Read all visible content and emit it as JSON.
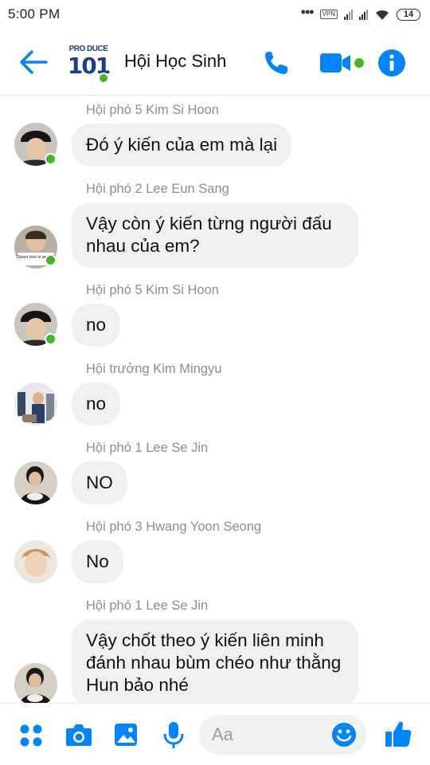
{
  "status_bar": {
    "time": "5:00 PM",
    "vpn": "VPN",
    "battery": "14"
  },
  "header": {
    "title": "Hội Học Sinh",
    "logo_top": "PRO DUCE",
    "logo_num": "101"
  },
  "colors": {
    "accent": "#0084ff",
    "online": "#42b72a",
    "bubble": "#f1f0f0",
    "sender": "#8a8d91"
  },
  "messages": [
    {
      "sender": "Hội phó 5 Kim Si Hoon",
      "text": "Đó ý kiến của em mà lại",
      "online": true
    },
    {
      "sender": "Hội phó 2 Lee Eun Sang",
      "text": "Vậy còn ý kiến từng người đấu nhau của em?",
      "online": true,
      "avatar_caption": "Gioeo tuoi vi anh cũ"
    },
    {
      "sender": "Hội phó 5 Kim Si Hoon",
      "text": "no",
      "online": true
    },
    {
      "sender": "Hội trưởng Kim Mingyu",
      "text": "no",
      "online": false
    },
    {
      "sender": "Hội phó 1 Lee Se Jin",
      "text": "NO",
      "online": false
    },
    {
      "sender": "Hội phó 3 Hwang Yoon Seong",
      "text": "No",
      "online": false
    },
    {
      "sender": "Hội phó 1 Lee Se Jin",
      "text": "Vậy chốt theo ý kiến liên minh đánh nhau bùm chéo như thằng Hun bảo nhé",
      "online": false
    }
  ],
  "composer": {
    "placeholder": "Aa"
  },
  "icons": [
    "back-arrow-icon",
    "phone-icon",
    "video-camera-icon",
    "info-icon",
    "apps-grid-icon",
    "camera-icon",
    "gallery-icon",
    "microphone-icon",
    "emoji-icon",
    "thumbs-up-icon"
  ]
}
